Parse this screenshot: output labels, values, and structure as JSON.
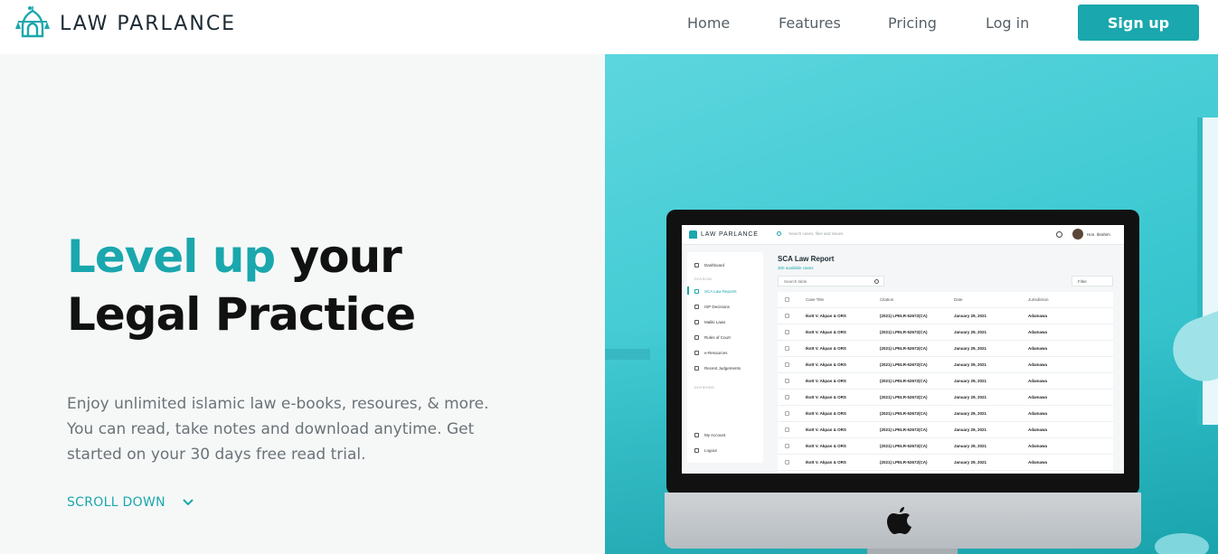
{
  "brand": {
    "name": "LAW PARLANCE"
  },
  "nav": {
    "home": "Home",
    "features": "Features",
    "pricing": "Pricing",
    "login": "Log in",
    "signup": "Sign up"
  },
  "hero": {
    "headline_accent": "Level up",
    "headline_rest": "your",
    "headline_line2": "Legal Practice",
    "subtext": "Enjoy unlimited islamic law e-books, resoures, & more. You can read, take notes and download anytime. Get started on your 30 days free read trial.",
    "scroll_label": "SCROLL DOWN"
  },
  "colors": {
    "accent": "#1aa7ad",
    "hero_bg": "#f6f8f8",
    "right_bg": "#3ec9d2"
  },
  "mockup": {
    "brand": "LAW PARLANCE",
    "search_placeholder": "Search cases, files and issues",
    "user": "Hon. Ibrahim",
    "sidebar": {
      "dashboard": "Dashboard",
      "section1": "DIVISION",
      "items": [
        "SCA Law Reports",
        "ISP Decisions",
        "Maliki Laws",
        "Rules of Court",
        "e-Resources",
        "Recent Judgements"
      ],
      "section2": "DIVISIONS",
      "account": "My Account",
      "logout": "Logout"
    },
    "page_title": "SCA Law Report",
    "available": "300 available cases",
    "table_search": "Search table",
    "filter": "Filter",
    "columns": [
      "Case Title",
      "Citation",
      "Date",
      "Jurisdiction"
    ],
    "rows": [
      [
        "Ikott V. Akpan & ORS",
        "(2021) LPELR-52672(CA)",
        "January 29, 2021",
        "Adamawa"
      ],
      [
        "Ikott V. Akpan & ORS",
        "(2021) LPELR-52672(CA)",
        "January 29, 2021",
        "Adamawa"
      ],
      [
        "Ikott V. Akpan & ORS",
        "(2021) LPELR-52672(CA)",
        "January 29, 2021",
        "Adamawa"
      ],
      [
        "Ikott V. Akpan & ORS",
        "(2021) LPELR-52672(CA)",
        "January 29, 2021",
        "Adamawa"
      ],
      [
        "Ikott V. Akpan & ORS",
        "(2021) LPELR-52672(CA)",
        "January 29, 2021",
        "Adamawa"
      ],
      [
        "Ikott V. Akpan & ORS",
        "(2021) LPELR-52672(CA)",
        "January 29, 2021",
        "Adamawa"
      ],
      [
        "Ikott V. Akpan & ORS",
        "(2021) LPELR-52672(CA)",
        "January 29, 2021",
        "Adamawa"
      ],
      [
        "Ikott V. Akpan & ORS",
        "(2021) LPELR-52672(CA)",
        "January 29, 2021",
        "Adamawa"
      ],
      [
        "Ikott V. Akpan & ORS",
        "(2021) LPELR-52672(CA)",
        "January 29, 2021",
        "Adamawa"
      ],
      [
        "Ikott V. Akpan & ORS",
        "(2021) LPELR-52672(CA)",
        "January 29, 2021",
        "Adamawa"
      ]
    ]
  }
}
